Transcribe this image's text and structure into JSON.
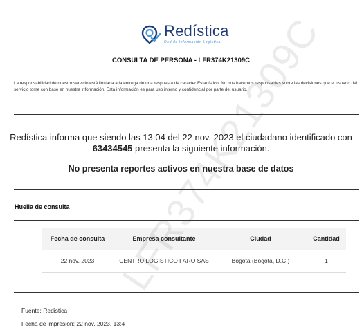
{
  "brand": {
    "name": "Redística",
    "tagline": "Red de Información Logística",
    "primary_color": "#1e3c78",
    "accent_color": "#4a9ad4",
    "icon": "location-pin-check-icon"
  },
  "document": {
    "title": "CONSULTA DE PERSONA - LFR374K21309C",
    "disclaimer": "La responsabilidad de nuestro servicio está limitada a la entrega de una respuesta de carácter Estadístico. No nos hacemos responsables sobre las decisiones que el usuario del servicio tome con base en nuestra información. Esta información es para uso interno y confidencial por parte del usuario."
  },
  "result": {
    "intro": "Redística informa que siendo las 13:04 del 22 nov. 2023 el ciudadano identificado con",
    "citizen_id": "63434545",
    "suffix": "presenta la siguiente información.",
    "status": "No presenta reportes activos en nuestra base de datos"
  },
  "query_trace": {
    "section_title": "Huella de consulta",
    "columns": [
      "Fecha de consulta",
      "Empresa consultante",
      "Ciudad",
      "Cantidad"
    ],
    "rows": [
      [
        "22 nov. 2023",
        "CENTRO LOGISTICO FARO SAS",
        "Bogota (Bogota, D.C.)",
        "1"
      ]
    ]
  },
  "footer": {
    "source_label": "Fuente:",
    "source_value": "Redistica",
    "print_label": "Fecha de impresión:",
    "print_value": "22 nov. 2023, 13:4"
  },
  "watermark": "LFR374K21309C"
}
